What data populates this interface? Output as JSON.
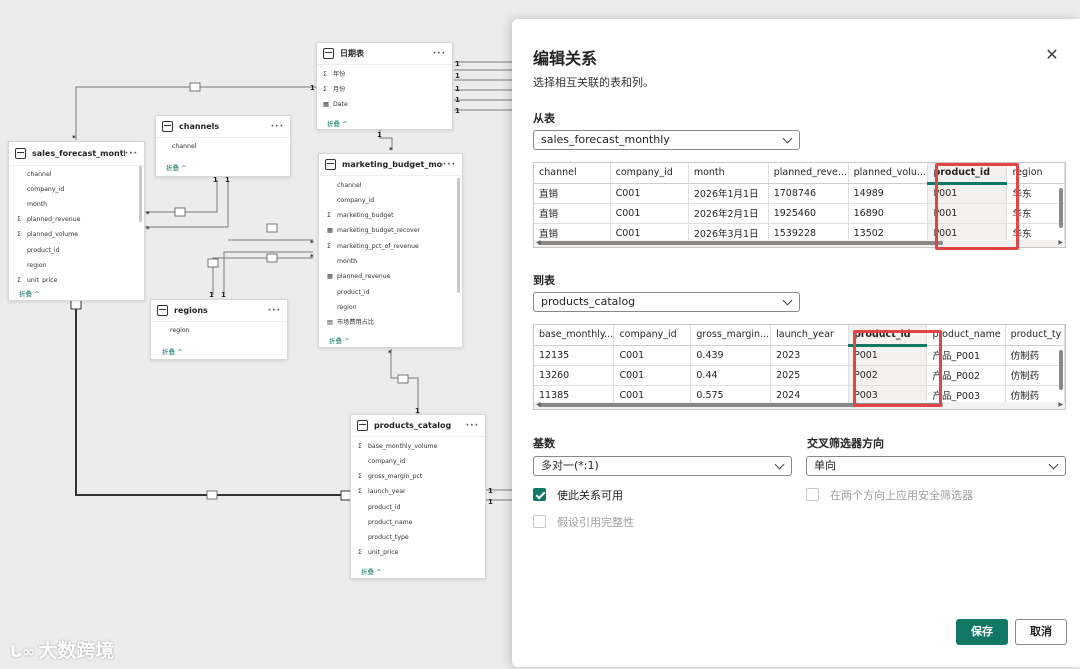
{
  "diagram": {
    "tables": {
      "date": {
        "title": "日期表",
        "fields": [
          {
            "icon": "sum-icon",
            "sig": "Σ",
            "name": "年份"
          },
          {
            "icon": "sum-icon",
            "sig": "Σ",
            "name": "月份"
          },
          {
            "icon": "calendar-icon",
            "sig": "▦",
            "name": "Date"
          }
        ],
        "fold": "折叠 ^"
      },
      "channels": {
        "title": "channels",
        "fields": [
          {
            "sig": "",
            "name": "channel"
          }
        ],
        "fold": "折叠 ^"
      },
      "sales": {
        "title": "sales_forecast_monthly",
        "fields": [
          {
            "sig": "",
            "name": "channel"
          },
          {
            "sig": "",
            "name": "company_id"
          },
          {
            "sig": "",
            "name": "month"
          },
          {
            "sig": "Σ",
            "name": "planned_revenue"
          },
          {
            "sig": "Σ",
            "name": "planned_volume"
          },
          {
            "sig": "",
            "name": "product_id"
          },
          {
            "sig": "",
            "name": "region"
          },
          {
            "sig": "Σ",
            "name": "unit_price"
          }
        ],
        "fold": "折叠 ^"
      },
      "marketing": {
        "title": "marketing_budget_monthly",
        "fields": [
          {
            "sig": "",
            "name": "channel"
          },
          {
            "sig": "",
            "name": "company_id"
          },
          {
            "sig": "Σ",
            "name": "marketing_budget"
          },
          {
            "sig": "▦",
            "name": "marketing_budget_recover"
          },
          {
            "sig": "Σ",
            "name": "marketing_pct_of_revenue"
          },
          {
            "sig": "",
            "name": "month"
          },
          {
            "sig": "▦",
            "name": "planned_revenue"
          },
          {
            "sig": "",
            "name": "product_id"
          },
          {
            "sig": "",
            "name": "region"
          },
          {
            "sig": "▤",
            "name": "市场费用占比"
          }
        ],
        "fold": "折叠 ^"
      },
      "regions": {
        "title": "regions",
        "fields": [
          {
            "sig": "",
            "name": "region"
          }
        ],
        "fold": "折叠 ^"
      },
      "products": {
        "title": "products_catalog",
        "fields": [
          {
            "sig": "Σ",
            "name": "base_monthly_volume"
          },
          {
            "sig": "",
            "name": "company_id"
          },
          {
            "sig": "Σ",
            "name": "gross_margin_pct"
          },
          {
            "sig": "Σ",
            "name": "launch_year"
          },
          {
            "sig": "",
            "name": "product_id"
          },
          {
            "sig": "",
            "name": "product_name"
          },
          {
            "sig": "",
            "name": "product_type"
          },
          {
            "sig": "Σ",
            "name": "unit_price"
          }
        ],
        "fold": "折叠 ^"
      }
    },
    "more_label": "···",
    "card_labels": {
      "one": "1",
      "many": "*"
    }
  },
  "panel": {
    "title": "编辑关系",
    "subtitle": "选择相互关联的表和列。",
    "from_label": "从表",
    "from_table": "sales_forecast_monthly",
    "from_columns": [
      "channel",
      "company_id",
      "month",
      "planned_reve...",
      "planned_volu...",
      "product_id",
      "region"
    ],
    "from_rows": [
      [
        "直销",
        "C001",
        "2026年1月1日",
        "1708746",
        "14989",
        "P001",
        "华东"
      ],
      [
        "直销",
        "C001",
        "2026年2月1日",
        "1925460",
        "16890",
        "P001",
        "华东"
      ],
      [
        "直销",
        "C001",
        "2026年3月1日",
        "1539228",
        "13502",
        "P001",
        "华东"
      ]
    ],
    "to_label": "到表",
    "to_table": "products_catalog",
    "to_columns": [
      "base_monthly...",
      "company_id",
      "gross_margin...",
      "launch_year",
      "product_id",
      "product_name",
      "product_ty"
    ],
    "to_rows": [
      [
        "12135",
        "C001",
        "0.439",
        "2023",
        "P001",
        "产品_P001",
        "仿制药"
      ],
      [
        "13260",
        "C001",
        "0.44",
        "2025",
        "P002",
        "产品_P002",
        "仿制药"
      ],
      [
        "11385",
        "C001",
        "0.575",
        "2024",
        "P003",
        "产品_P003",
        "仿制药"
      ]
    ],
    "cardinality_label": "基数",
    "cardinality_value": "多对一(*:1)",
    "crossfilter_label": "交叉筛选器方向",
    "crossfilter_value": "单向",
    "make_active": "使此关系可用",
    "security_filter": "在两个方向上应用安全筛选器",
    "assume_integrity": "假设引用完整性",
    "save": "保存",
    "cancel": "取消",
    "selected_color": "#117865",
    "highlight_color": "#e04646"
  },
  "watermark": "大数跨境"
}
